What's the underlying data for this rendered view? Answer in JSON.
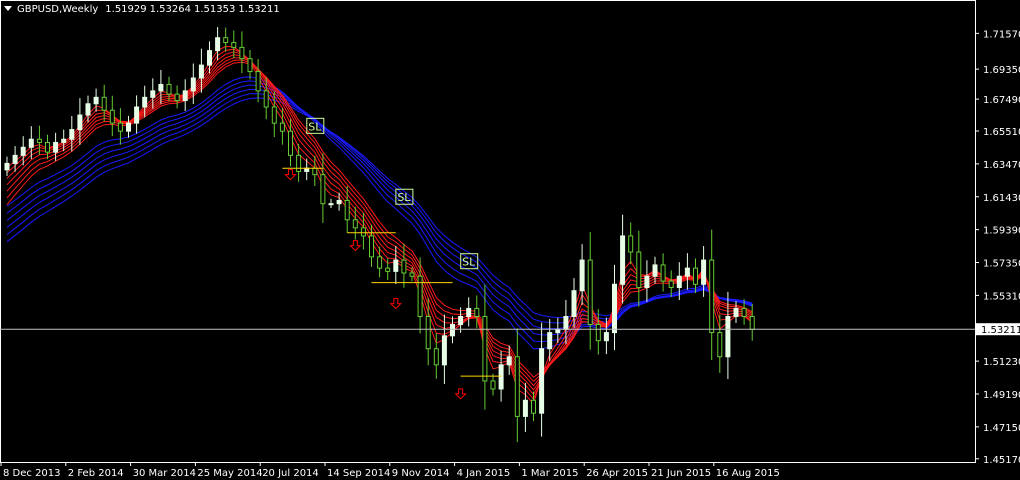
{
  "header": {
    "symbol": "GBPUSD,Weekly",
    "open": "1.51929",
    "high": "1.53264",
    "low": "1.51353",
    "close": "1.53211"
  },
  "colors": {
    "background": "#000000",
    "axis": "#ffffff",
    "bull_candle": "#e6ffe6",
    "bear_candle": "#66cc33",
    "fast_ribbon": "#ff1a1a",
    "slow_ribbon": "#1a1aff",
    "signal_arrow": "#ff0000",
    "sl_box": "#ccff99",
    "stop_line": "#ffd700",
    "price_line": "#c0c0c0"
  },
  "chart_data": {
    "type": "candlestick",
    "title": "GBPUSD,Weekly",
    "x_tick_labels": [
      "8 Dec 2013",
      "2 Feb 2014",
      "30 Mar 2014",
      "25 May 2014",
      "20 Jul 2014",
      "14 Sep 2014",
      "9 Nov 2014",
      "4 Jan 2015",
      "1 Mar 2015",
      "26 Apr 2015",
      "21 Jun 2015",
      "16 Aug 2015"
    ],
    "x_tick_bar_index": [
      0,
      8,
      16,
      24,
      32,
      40,
      48,
      56,
      64,
      72,
      80,
      88
    ],
    "y_ticks": [
      1.7157,
      1.6935,
      1.6749,
      1.6551,
      1.6347,
      1.6143,
      1.5939,
      1.5735,
      1.5531,
      1.5123,
      1.4919,
      1.4715,
      1.4517
    ],
    "ylim": [
      1.4497,
      1.7302
    ],
    "current_price": 1.53211,
    "close": [
      1.635,
      1.64,
      1.645,
      1.65,
      1.648,
      1.642,
      1.648,
      1.65,
      1.656,
      1.665,
      1.672,
      1.676,
      1.668,
      1.66,
      1.655,
      1.66,
      1.67,
      1.676,
      1.68,
      1.684,
      1.678,
      1.674,
      1.68,
      1.688,
      1.696,
      1.705,
      1.713,
      1.71,
      1.707,
      1.7,
      1.692,
      1.68,
      1.67,
      1.66,
      1.655,
      1.64,
      1.63,
      1.632,
      1.628,
      1.61,
      1.61,
      1.612,
      1.6,
      1.595,
      1.59,
      1.577,
      1.57,
      1.568,
      1.575,
      1.567,
      1.565,
      1.54,
      1.52,
      1.51,
      1.528,
      1.535,
      1.54,
      1.545,
      1.54,
      1.5,
      1.495,
      1.51,
      1.515,
      1.478,
      1.488,
      1.48,
      1.52,
      1.53,
      1.532,
      1.54,
      1.556,
      1.575,
      1.535,
      1.525,
      1.53,
      1.56,
      1.59,
      1.58,
      1.558,
      1.565,
      1.572,
      1.562,
      1.558,
      1.565,
      1.57,
      1.56,
      1.575,
      1.53,
      1.515,
      1.54,
      1.545,
      1.54,
      1.532
    ],
    "series": [
      {
        "name": "EMA ribbon fast",
        "color": "#ff1a1a"
      },
      {
        "name": "EMA ribbon slow",
        "color": "#1a1aff"
      }
    ],
    "annotations": {
      "sl_labels": [
        "SL",
        "SL",
        "SL"
      ],
      "sl_bar_index": [
        38,
        49,
        57
      ],
      "sl_price": [
        1.658,
        1.614,
        1.574
      ],
      "sell_arrow_bar_index": [
        35,
        43,
        48,
        56
      ],
      "sell_arrow_price": [
        1.628,
        1.584,
        1.548,
        1.492
      ],
      "stop_lines": [
        {
          "from_bar": 34,
          "to_bar": 39,
          "price": 1.632
        },
        {
          "from_bar": 42,
          "to_bar": 48,
          "price": 1.592
        },
        {
          "from_bar": 45,
          "to_bar": 55,
          "price": 1.561
        },
        {
          "from_bar": 56,
          "to_bar": 61,
          "price": 1.503
        }
      ]
    }
  }
}
